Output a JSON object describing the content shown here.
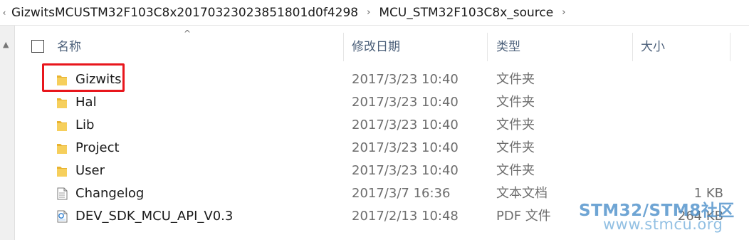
{
  "breadcrumb": {
    "items": [
      "GizwitsMCUSTM32F103C8x20170323023851801d0f4298",
      "MCU_STM32F103C8x_source"
    ],
    "separator": "›",
    "lead": "‹"
  },
  "columns": {
    "name": "名称",
    "date": "修改日期",
    "type": "类型",
    "size": "大小",
    "sort_indicator": "^"
  },
  "files": [
    {
      "name": "Gizwits",
      "date": "2017/3/23 10:40",
      "type": "文件夹",
      "size": "",
      "icon": "folder-icon"
    },
    {
      "name": "Hal",
      "date": "2017/3/23 10:40",
      "type": "文件夹",
      "size": "",
      "icon": "folder-icon"
    },
    {
      "name": "Lib",
      "date": "2017/3/23 10:40",
      "type": "文件夹",
      "size": "",
      "icon": "folder-icon"
    },
    {
      "name": "Project",
      "date": "2017/3/23 10:40",
      "type": "文件夹",
      "size": "",
      "icon": "folder-icon"
    },
    {
      "name": "User",
      "date": "2017/3/23 10:40",
      "type": "文件夹",
      "size": "",
      "icon": "folder-icon"
    },
    {
      "name": "Changelog",
      "date": "2017/3/7 16:36",
      "type": "文本文档",
      "size": "1 KB",
      "icon": "text-file-icon"
    },
    {
      "name": "DEV_SDK_MCU_API_V0.3",
      "date": "2017/2/13 10:48",
      "type": "PDF 文件",
      "size": "264 KB",
      "icon": "pdf-file-icon"
    }
  ],
  "highlight": {
    "target": "Gizwits",
    "color": "#e8161c"
  },
  "watermark": {
    "line1": "STM32/STM8社区",
    "line2": "www.stmcu.org"
  },
  "colors": {
    "header_text": "#4c607a",
    "folder": "#f2c14e",
    "detail_text": "#6d6d6d"
  }
}
